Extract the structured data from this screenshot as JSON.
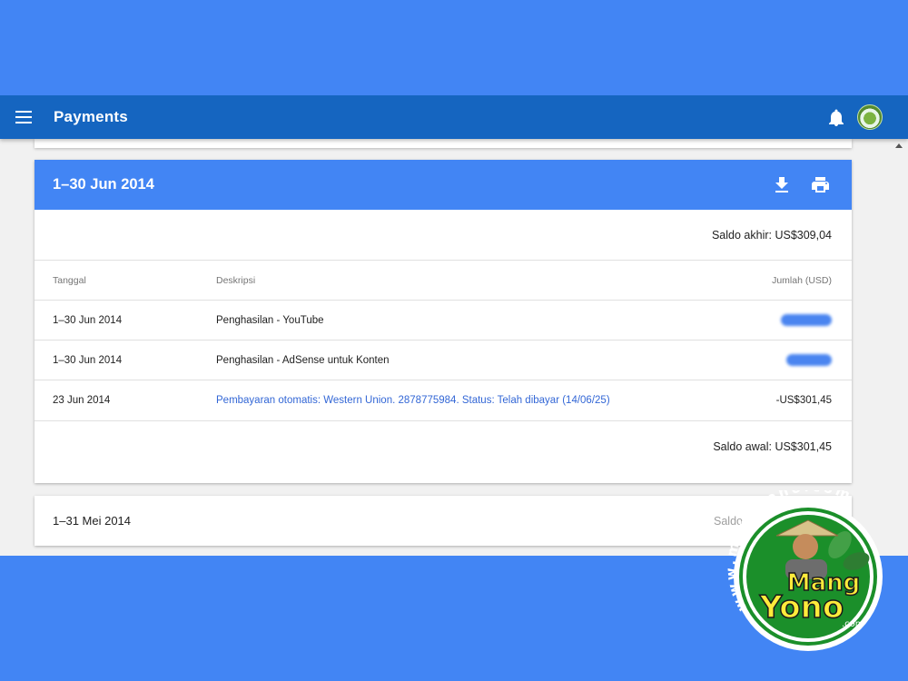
{
  "appbar": {
    "title": "Payments"
  },
  "icons": {
    "menu": "menu-icon",
    "notifications": "bell-icon",
    "download": "download-icon",
    "print": "print-icon"
  },
  "colors": {
    "page_background": "#4285f4",
    "appbar": "#1565c0",
    "card_header": "#4285f4",
    "link": "#3367d6"
  },
  "june_card": {
    "title": "1–30 Jun 2014",
    "ending_balance": "Saldo akhir: US$309,04",
    "columns": {
      "date": "Tanggal",
      "description": "Deskripsi",
      "amount": "Jumlah (USD)"
    },
    "rows": [
      {
        "date": "1–30 Jun 2014",
        "description": "Penghasilan - YouTube",
        "amount": ""
      },
      {
        "date": "1–30 Jun 2014",
        "description": "Penghasilan - AdSense untuk Konten",
        "amount": ""
      },
      {
        "date": "23 Jun 2014",
        "description": "Pembayaran otomatis: Western Union. 2878775984. Status: Telah dibayar (14/06/25)",
        "amount": "-US$301,45"
      }
    ],
    "starting_balance": "Saldo awal: US$301,45"
  },
  "may_card": {
    "title": "1–31 Mei 2014",
    "right_label": "Saldo"
  },
  "watermark": {
    "url_text": "www.mangyono.com",
    "name_top": "Mang",
    "name_bottom": "Yono",
    "suffix": ".com"
  }
}
